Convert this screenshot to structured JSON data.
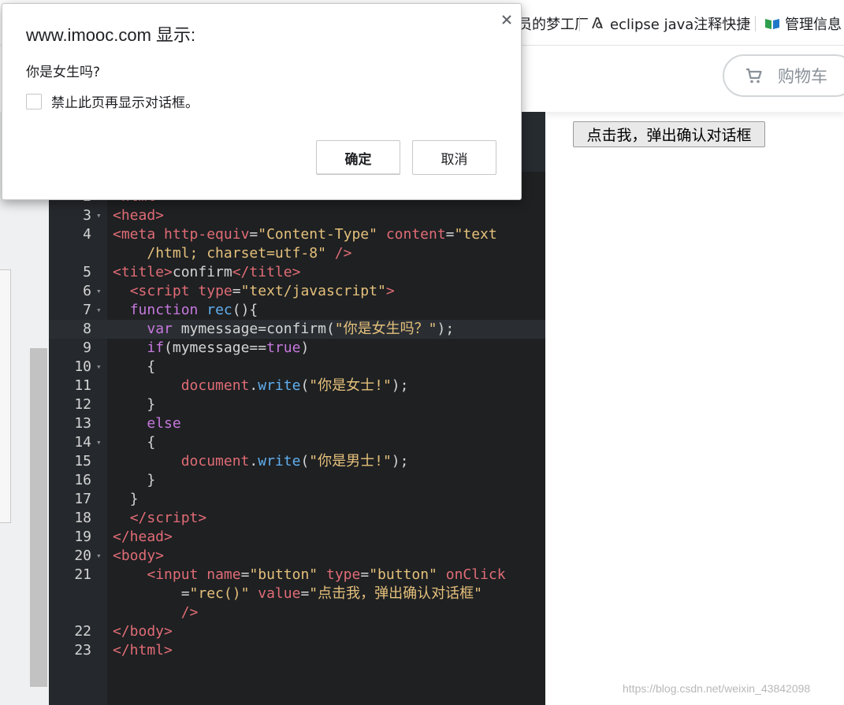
{
  "bookmarks": [
    {
      "label": "员的梦工厂",
      "icon": "none"
    },
    {
      "label": "eclipse java注释快捷",
      "icon": "eclipse-icon"
    },
    {
      "label": "管理信息",
      "icon": "book-icon"
    }
  ],
  "header": {
    "cart_label": "购物车",
    "cart_color": "#8a9199"
  },
  "page": {
    "button_value": "点击我，弹出确认对话框",
    "watermark": "https://blog.csdn.net/weixin_43842098"
  },
  "dialog": {
    "title": "www.imooc.com 显示:",
    "message": "你是女生吗?",
    "checkbox_label": "禁止此页再显示对话框。",
    "ok_label": "确定",
    "cancel_label": "取消"
  },
  "editor": {
    "lines": [
      {
        "n": "2",
        "fold": false,
        "html": "<span class='tag'>&lt;html&gt;</span>"
      },
      {
        "n": "3",
        "fold": true,
        "html": "<span class='tag'>&lt;head&gt;</span>"
      },
      {
        "n": "4",
        "fold": false,
        "html": "<span class='tag'>&lt;meta</span> <span class='attr'>http-equiv</span><span class='plain'>=</span><span class='str'>\"Content-Type\"</span> <span class='attr'>content</span><span class='plain'>=</span><span class='str'>\"text</span>"
      },
      {
        "n": "",
        "fold": false,
        "html": "    <span class='str'>/html; charset=utf-8\"</span> <span class='tag'>/&gt;</span>"
      },
      {
        "n": "5",
        "fold": false,
        "html": "<span class='tag'>&lt;title&gt;</span><span class='plain'>confirm</span><span class='tag'>&lt;/title&gt;</span>"
      },
      {
        "n": "6",
        "fold": true,
        "html": "  <span class='tag'>&lt;script</span> <span class='attr'>type</span><span class='plain'>=</span><span class='str'>\"text/javascript\"</span><span class='tag'>&gt;</span>"
      },
      {
        "n": "7",
        "fold": true,
        "html": "  <span class='kw'>function</span> <span class='fn'>rec</span><span class='plain'>(){</span>"
      },
      {
        "n": "8",
        "fold": false,
        "cur": true,
        "html": "    <span class='kw'>var</span> <span class='plain'>mymessage=confirm(</span><span class='str'>\"你是女生吗？\"</span><span class='plain'>);</span>"
      },
      {
        "n": "9",
        "fold": false,
        "html": "    <span class='kw'>if</span><span class='plain'>(mymessage==</span><span class='kw'>true</span><span class='plain'>)</span>"
      },
      {
        "n": "10",
        "fold": true,
        "html": "    <span class='plain'>{</span>"
      },
      {
        "n": "11",
        "fold": false,
        "html": "        <span class='attr'>document</span><span class='plain'>.</span><span class='fn'>write</span><span class='plain'>(</span><span class='str'>\"你是女士!\"</span><span class='plain'>);</span>"
      },
      {
        "n": "12",
        "fold": false,
        "html": "    <span class='plain'>}</span>"
      },
      {
        "n": "13",
        "fold": false,
        "html": "    <span class='kw'>else</span>"
      },
      {
        "n": "14",
        "fold": true,
        "html": "    <span class='plain'>{</span>"
      },
      {
        "n": "15",
        "fold": false,
        "html": "        <span class='attr'>document</span><span class='plain'>.</span><span class='fn'>write</span><span class='plain'>(</span><span class='str'>\"你是男士!\"</span><span class='plain'>);</span>"
      },
      {
        "n": "16",
        "fold": false,
        "html": "    <span class='plain'>}</span>"
      },
      {
        "n": "17",
        "fold": false,
        "html": "  <span class='plain'>}</span>"
      },
      {
        "n": "18",
        "fold": false,
        "html": "  <span class='tag'>&lt;/script&gt;</span>"
      },
      {
        "n": "19",
        "fold": false,
        "html": "<span class='tag'>&lt;/head&gt;</span>"
      },
      {
        "n": "20",
        "fold": true,
        "html": "<span class='tag'>&lt;body&gt;</span>"
      },
      {
        "n": "21",
        "fold": false,
        "html": "    <span class='tag'>&lt;input</span> <span class='attr'>name</span><span class='plain'>=</span><span class='str'>\"button\"</span> <span class='attr'>type</span><span class='plain'>=</span><span class='str'>\"button\"</span> <span class='attr'>onClick</span>"
      },
      {
        "n": "",
        "fold": false,
        "html": "        <span class='plain'>=</span><span class='str'>\"rec()\"</span> <span class='attr'>value</span><span class='plain'>=</span><span class='str'>\"点击我，弹出确认对话框\"</span>"
      },
      {
        "n": "",
        "fold": false,
        "html": "        <span class='tag'>/&gt;</span>"
      },
      {
        "n": "22",
        "fold": false,
        "html": "<span class='tag'>&lt;/body&gt;</span>"
      },
      {
        "n": "23",
        "fold": false,
        "html": "<span class='tag'>&lt;/html&gt;</span>"
      }
    ]
  }
}
